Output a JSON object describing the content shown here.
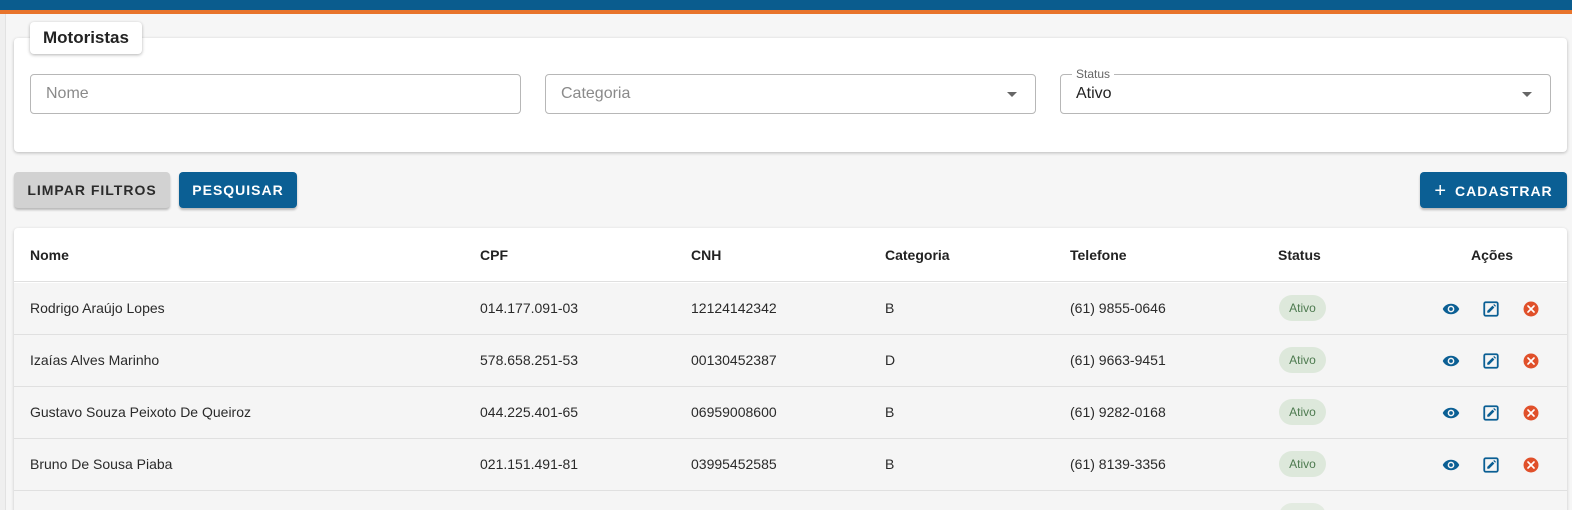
{
  "page": {
    "title": "Motoristas"
  },
  "filters": {
    "nome": {
      "placeholder": "Nome"
    },
    "categoria": {
      "placeholder": "Categoria"
    },
    "status": {
      "label": "Status",
      "value": "Ativo"
    }
  },
  "actions": {
    "clear_label": "LIMPAR FILTROS",
    "search_label": "PESQUISAR",
    "add_label": "CADASTRAR",
    "add_icon": "plus-icon"
  },
  "table": {
    "columns": [
      "Nome",
      "CPF",
      "CNH",
      "Categoria",
      "Telefone",
      "Status",
      "Ações"
    ],
    "rows": [
      {
        "nome": "Rodrigo Araújo Lopes",
        "cpf": "014.177.091-03",
        "cnh": "12124142342",
        "categoria": "B",
        "telefone": "(61) 9855-0646",
        "status": "Ativo"
      },
      {
        "nome": "Izaías Alves Marinho",
        "cpf": "578.658.251-53",
        "cnh": "00130452387",
        "categoria": "D",
        "telefone": "(61) 9663-9451",
        "status": "Ativo"
      },
      {
        "nome": "Gustavo Souza Peixoto De Queiroz",
        "cpf": "044.225.401-65",
        "cnh": "06959008600",
        "categoria": "B",
        "telefone": "(61) 9282-0168",
        "status": "Ativo"
      },
      {
        "nome": "Bruno De Sousa Piaba",
        "cpf": "021.151.491-81",
        "cnh": "03995452585",
        "categoria": "B",
        "telefone": "(61) 8139-3356",
        "status": "Ativo"
      }
    ],
    "row_actions": [
      "eye-icon",
      "edit-icon",
      "delete-icon"
    ]
  },
  "colors": {
    "primary": "#0b5f94",
    "accent": "#e8742c",
    "delete": "#e0502a",
    "badge_bg": "#dde8db",
    "badge_text": "#4d7a4f"
  }
}
